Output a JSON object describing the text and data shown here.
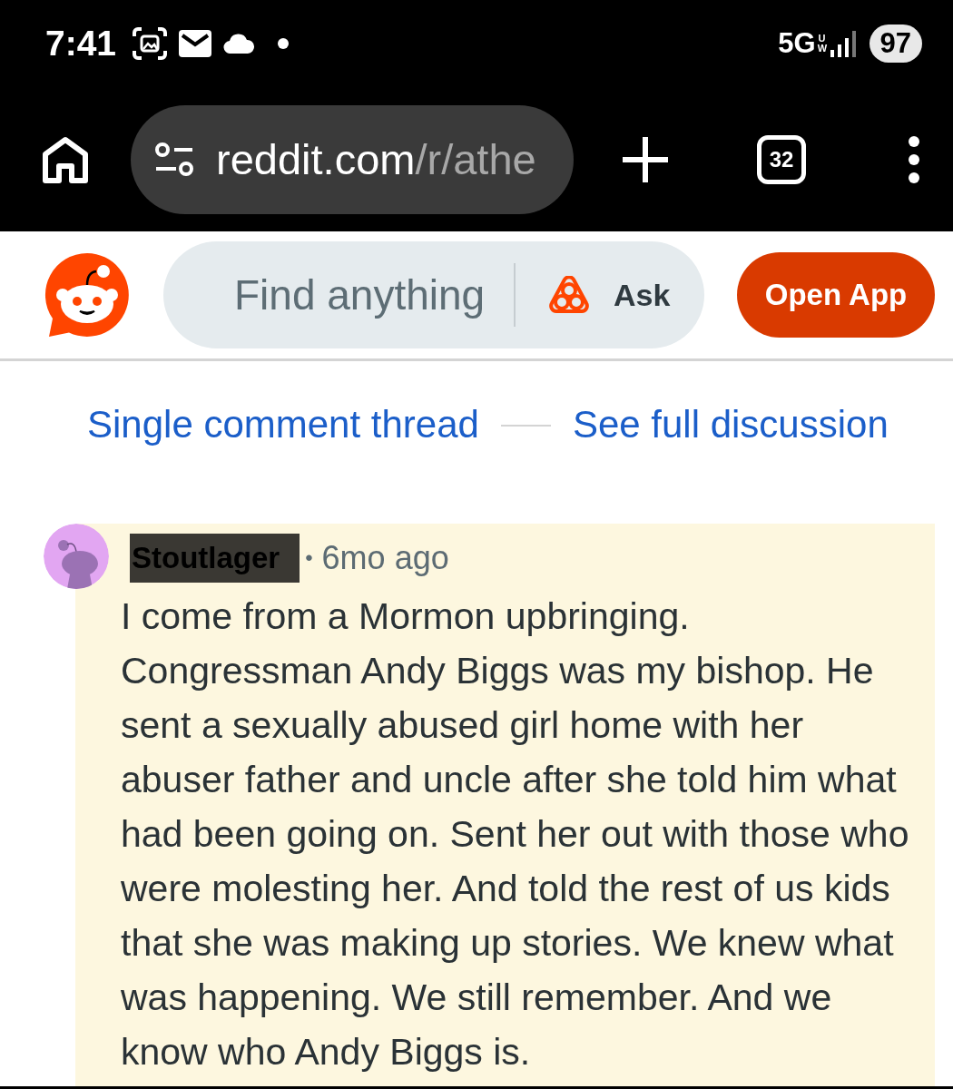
{
  "status_bar": {
    "time": "7:41",
    "network": "5G",
    "network_badge": "UW",
    "battery": "97"
  },
  "browser": {
    "url": {
      "host": "reddit.com",
      "path": "/r/athe"
    },
    "tab_count": "32"
  },
  "header": {
    "search": {
      "placeholder": "Find anything"
    },
    "ask": "Ask",
    "open_app": "Open App"
  },
  "thread_nav": {
    "links": [
      "Single comment thread",
      "See full discussion"
    ]
  },
  "comment": {
    "author": "Stoutlager",
    "author_redacted": true,
    "separator": "•",
    "timestamp": "6mo ago",
    "highlighted": true,
    "body": "I come from a Mormon upbringing. Congressman Andy Biggs was my bishop. He sent a sexually abused girl home with her abuser father and uncle after she told him what had been going on. Sent her out with those who were molesting her. And told the rest of us kids that she was making up stories. We knew what was happening. We still remember. And we know who Andy Biggs is."
  }
}
